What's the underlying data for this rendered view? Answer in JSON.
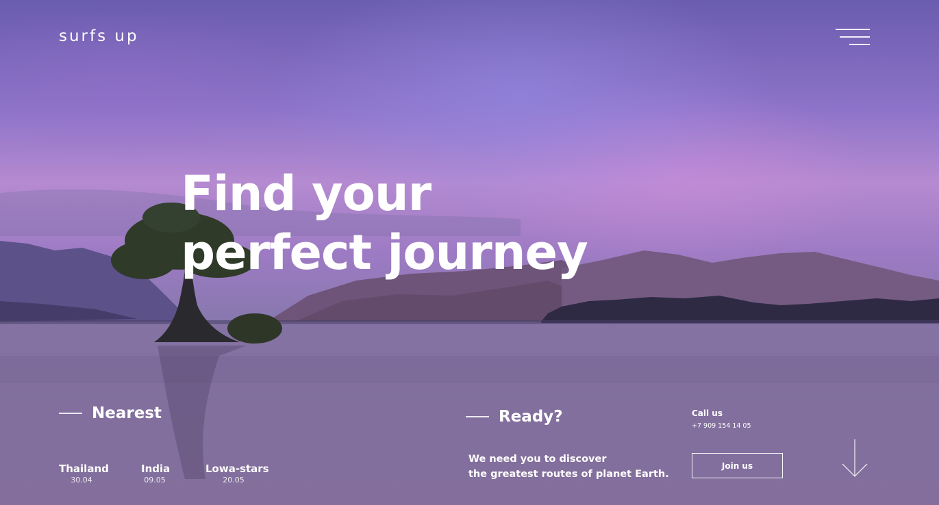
{
  "header": {
    "brand": "surfs up",
    "menu_icon": "menu-lines-icon"
  },
  "hero": {
    "headline_line1": "Find your",
    "headline_line2": "perfect journey"
  },
  "nearest": {
    "heading": "Nearest",
    "destinations": [
      {
        "name": "Thailand",
        "date": "30.04"
      },
      {
        "name": "India",
        "date": "09.05"
      },
      {
        "name": "Lowa-stars",
        "date": "20.05"
      }
    ]
  },
  "ready": {
    "heading": "Ready?",
    "tagline_line1": "We need you to discover",
    "tagline_line2": "the greatest routes of planet Earth."
  },
  "contact": {
    "call_label": "Call us",
    "phone": "+7 909 154 14 05",
    "join_label": "Join us"
  },
  "scroll": {
    "icon": "arrow-down-icon"
  },
  "colors": {
    "text": "#ffffff",
    "sky_top": "#6a5cae",
    "sky_glow": "#b58ad0",
    "water": "#866f9c"
  }
}
